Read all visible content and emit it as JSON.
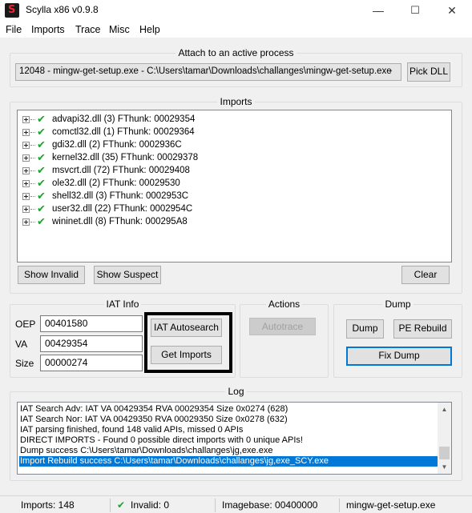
{
  "window": {
    "title": "Scylla x86 v0.9.8",
    "minimize": "—",
    "maximize": "☐",
    "close": "✕"
  },
  "menu": [
    "File",
    "Imports",
    "Trace",
    "Misc",
    "Help"
  ],
  "attach": {
    "title": "Attach to an active process",
    "process": "12048 - mingw-get-setup.exe - C:\\Users\\tamar\\Downloads\\challanges\\mingw-get-setup.exe",
    "pick_dll": "Pick DLL"
  },
  "imports": {
    "title": "Imports",
    "items": [
      "advapi32.dll (3) FThunk: 00029354",
      "comctl32.dll (1) FThunk: 00029364",
      "gdi32.dll (2) FThunk: 0002936C",
      "kernel32.dll (35) FThunk: 00029378",
      "msvcrt.dll (72) FThunk: 00029408",
      "ole32.dll (2) FThunk: 00029530",
      "shell32.dll (3) FThunk: 0002953C",
      "user32.dll (22) FThunk: 0002954C",
      "wininet.dll (8) FThunk: 000295A8"
    ],
    "show_invalid": "Show Invalid",
    "show_suspect": "Show Suspect",
    "clear": "Clear"
  },
  "iat": {
    "title": "IAT Info",
    "oep_label": "OEP",
    "oep": "00401580",
    "va_label": "VA",
    "va": "00429354",
    "size_label": "Size",
    "size": "00000274",
    "autosearch": "IAT Autosearch",
    "get_imports": "Get Imports"
  },
  "actions": {
    "title": "Actions",
    "autotrace": "Autotrace"
  },
  "dump": {
    "title": "Dump",
    "dump": "Dump",
    "pe_rebuild": "PE Rebuild",
    "fix_dump": "Fix Dump"
  },
  "log": {
    "title": "Log",
    "lines": [
      "IAT Search Adv: IAT VA 00429354 RVA 00029354 Size 0x0274 (628)",
      "IAT Search Nor: IAT VA 00429350 RVA 00029350 Size 0x0278 (632)",
      "IAT parsing finished, found 148 valid APIs, missed 0 APIs",
      "DIRECT IMPORTS - Found 0 possible direct imports with 0 unique APIs!",
      "Dump success C:\\Users\\tamar\\Downloads\\challanges\\jg,exe.exe",
      "Import Rebuild success C:\\Users\\tamar\\Downloads\\challanges\\jg,exe_SCY.exe"
    ]
  },
  "status": {
    "imports": "Imports: 148",
    "invalid": "Invalid: 0",
    "imagebase": "Imagebase: 00400000",
    "module": "mingw-get-setup.exe"
  },
  "colors": {
    "accent": "#0078d7",
    "check": "#22a032",
    "highlight_box": "#000000"
  }
}
